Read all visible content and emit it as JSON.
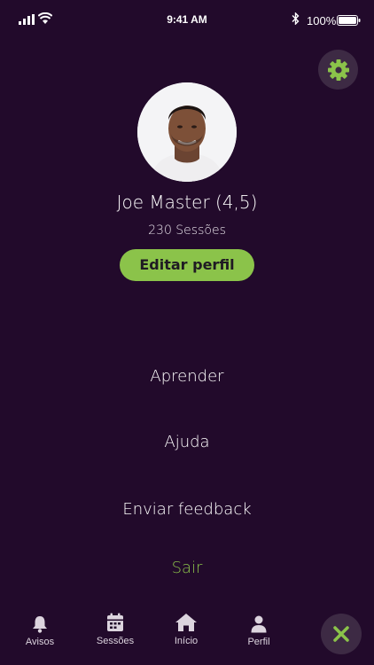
{
  "status_bar": {
    "time": "9:41 AM",
    "battery_text": "100%",
    "icons": [
      "signal-icon",
      "wifi-icon",
      "bluetooth-icon",
      "battery-icon"
    ]
  },
  "header": {
    "settings_icon": "gear-icon"
  },
  "profile": {
    "name": "Joe Master (4,5)",
    "sessions": "230 Sessões",
    "edit_label": "Editar perfil"
  },
  "menu": {
    "learn": "Aprender",
    "help": "Ajuda",
    "feedback": "Enviar feedback",
    "logout": "Sair"
  },
  "tab_bar": {
    "items": [
      {
        "label": "Avisos",
        "icon": "bell-icon"
      },
      {
        "label": "Sessões",
        "icon": "calendar-icon"
      },
      {
        "label": "Início",
        "icon": "home-icon"
      },
      {
        "label": "Perfil",
        "icon": "person-icon"
      }
    ],
    "close_icon": "close-icon"
  },
  "colors": {
    "background": "#220a2b",
    "accent": "#8bc34a",
    "button_bg": "#3d2a44",
    "text": "#ffffff"
  }
}
